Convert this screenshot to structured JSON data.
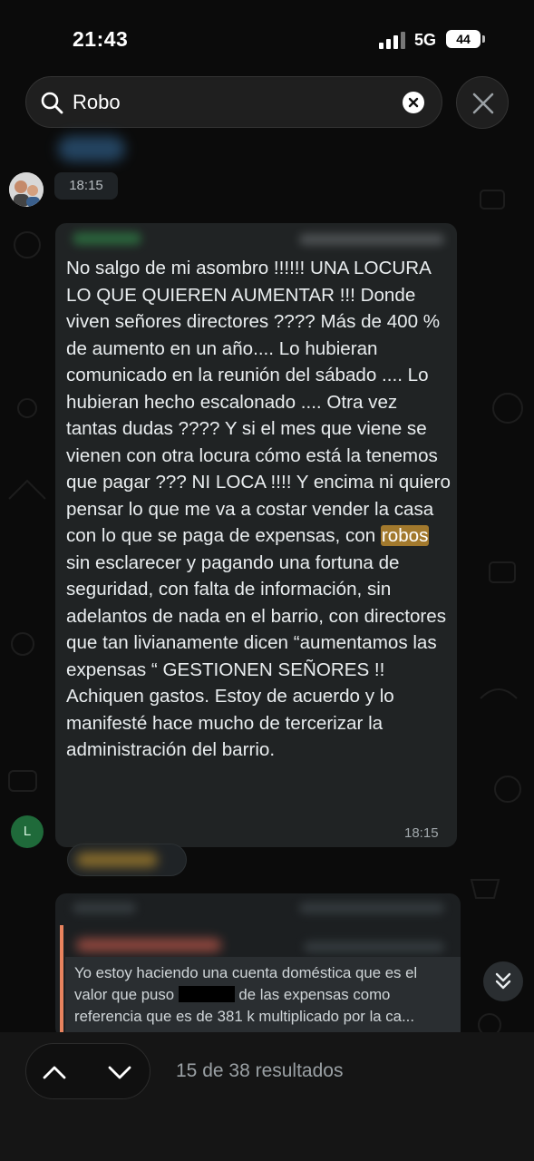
{
  "status_bar": {
    "time": "21:43",
    "network": "5G",
    "battery": "44"
  },
  "search": {
    "value": "Robo"
  },
  "messages": [
    {
      "time": "18:15"
    },
    {
      "text_before": "No salgo de mi asombro !!!!!! UNA LOCURA LO QUE QUIEREN AUMENTAR !!! Donde viven señores directores ???? Más de 400 % de aumento en un año.... Lo hubieran comunicado en la reunión del sábado .... Lo hubieran hecho escalonado .... Otra vez tantas dudas ???? Y si el mes que viene se vienen con otra locura cómo está la tenemos que pagar ??? NI LOCA !!!! Y encima ni quiero pensar lo que me va a costar vender la casa con lo que se paga de expensas, con ",
      "highlight": "robos",
      "text_after": " sin esclarecer y pagando una fortuna de seguridad, con falta de información, sin adelantos de nada en el barrio, con directores que tan  livianamente dicen “aumentamos las expensas “ GESTIONEN SEÑORES !! Achiquen gastos. Estoy de acuerdo y lo manifesté hace mucho de tercerizar la administración del barrio.",
      "time": "18:15",
      "avatar_initial": "L"
    },
    {
      "quote_before": "Yo estoy haciendo una cuenta doméstica que es el valor que puso ",
      "quote_after": " de las expensas como referencia que es de 381 k multiplicado por la ca..."
    }
  ],
  "footer": {
    "results": "15 de 38 resultados"
  },
  "colors": {
    "highlight": "#a2792d",
    "bubble": "#202324",
    "quote_bar": "#e8835e",
    "avatar_l": "#1f6a3a"
  },
  "icons": [
    "search-icon",
    "clear-icon",
    "close-icon",
    "chevron-up-icon",
    "chevron-down-icon",
    "double-chevron-down-icon"
  ]
}
